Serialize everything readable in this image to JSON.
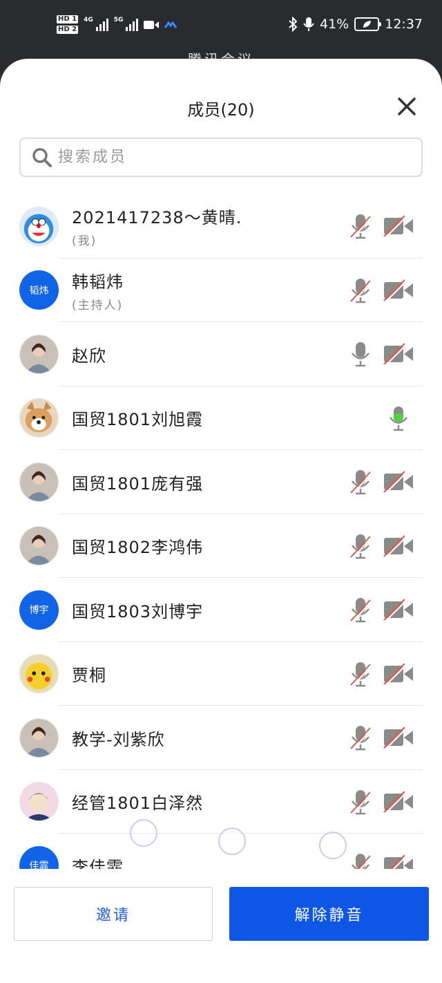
{
  "status_bar": {
    "hd1": "HD 1",
    "hd2": "HD 2",
    "net1": "4G",
    "net2": "5G",
    "battery_percent": "41%",
    "time": "12:37"
  },
  "meeting_peek": "腾讯会议",
  "panel": {
    "title": "成员(20)",
    "search_placeholder": "搜索成员"
  },
  "colors": {
    "accent": "#0d56e6",
    "mic_active": "#4cd43b",
    "muted_slash": "#e05a4a",
    "icon_gray": "#8a8a8a"
  },
  "members": [
    {
      "name": "2021417238～黄晴.",
      "role": "(我)",
      "avatar_icon": "doraemon-avatar",
      "mic": "muted",
      "camera": "off"
    },
    {
      "name": "韩韬炜",
      "role": "(主持人)",
      "avatar_text": "韬炜",
      "mic": "muted",
      "camera": "off"
    },
    {
      "name": "赵欣",
      "role": "",
      "avatar_icon": "person-photo-avatar",
      "mic": "on",
      "camera": "off"
    },
    {
      "name": "国贸1801刘旭霞",
      "role": "",
      "avatar_icon": "dog-avatar",
      "mic": "speaking",
      "camera": "none"
    },
    {
      "name": "国贸1801庞有强",
      "role": "",
      "avatar_icon": "person-photo-avatar",
      "mic": "muted",
      "camera": "off"
    },
    {
      "name": "国贸1802李鸿伟",
      "role": "",
      "avatar_icon": "person-photo-avatar",
      "mic": "muted",
      "camera": "off"
    },
    {
      "name": "国贸1803刘博宇",
      "role": "",
      "avatar_text": "博宇",
      "mic": "muted",
      "camera": "off"
    },
    {
      "name": "贾桐",
      "role": "",
      "avatar_icon": "pikachu-avatar",
      "mic": "muted",
      "camera": "off"
    },
    {
      "name": "教学-刘紫欣",
      "role": "",
      "avatar_icon": "person-photo-avatar",
      "mic": "muted",
      "camera": "off"
    },
    {
      "name": "经管1801白泽然",
      "role": "",
      "avatar_icon": "anime-avatar",
      "mic": "muted",
      "camera": "off"
    },
    {
      "name": "李佳霏",
      "role": "",
      "avatar_text": "佳霏",
      "mic": "muted",
      "camera": "off"
    }
  ],
  "footer": {
    "invite_label": "邀请",
    "unmute_label": "解除静音"
  }
}
